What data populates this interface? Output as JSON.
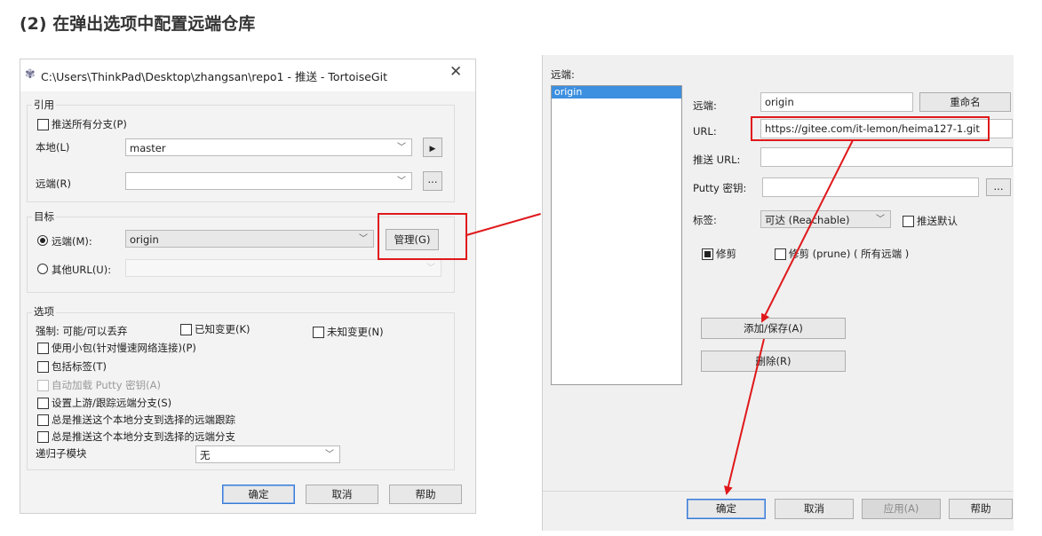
{
  "page_heading": "(2) 在弹出选项中配置远端仓库",
  "left": {
    "title": "C:\\Users\\ThinkPad\\Desktop\\zhangsan\\repo1 - 推送 - TortoiseGit",
    "ref_group": "引用",
    "push_all": "推送所有分支(P)",
    "local_label": "本地(L)",
    "local_value": "master",
    "remote_label": "远端(R)",
    "target_group": "目标",
    "remote_radio": "远端(M):",
    "remote_value": "origin",
    "manage_btn": "管理(G)",
    "other_url": "其他URL(U):",
    "options_group": "选项",
    "force_label": "强制: 可能/可以丢弃",
    "known_changes": "已知变更(K)",
    "unknown_changes": "未知变更(N)",
    "thin_pack": "使用小包(针对慢速网络连接)(P)",
    "include_tags": "包括标签(T)",
    "autoload_putty": "自动加载 Putty 密钥(A)",
    "set_upstream": "设置上游/跟踪远端分支(S)",
    "always_push_track": "总是推送这个本地分支到选择的远端跟踪",
    "always_push_branch": "总是推送这个本地分支到选择的远端分支",
    "recurse_label": "递归子模块",
    "recurse_value": "无",
    "ok": "确定",
    "cancel": "取消",
    "help": "帮助"
  },
  "right": {
    "remotes_label": "远端:",
    "list_items": [
      "origin"
    ],
    "remote_field_label": "远端:",
    "remote_field_value": "origin",
    "rename_btn": "重命名",
    "url_label": "URL:",
    "url_value": "https://gitee.com/it-lemon/heima127-1.git",
    "push_url_label": "推送 URL:",
    "putty_label": "Putty 密钥:",
    "putty_btn": "...",
    "tags_label": "标签:",
    "tags_value": "可达 (Reachable)",
    "push_default": "推送默认",
    "prune_checked": "修剪",
    "prune_all": "修剪 (prune) ( 所有远端 )",
    "add_save": "添加/保存(A)",
    "remove": "删除(R)",
    "ok": "确定",
    "cancel": "取消",
    "apply": "应用(A)",
    "help": "帮助"
  },
  "colors": {
    "annotation_red": "#e0181b",
    "selection_blue": "#3d8fe0"
  }
}
